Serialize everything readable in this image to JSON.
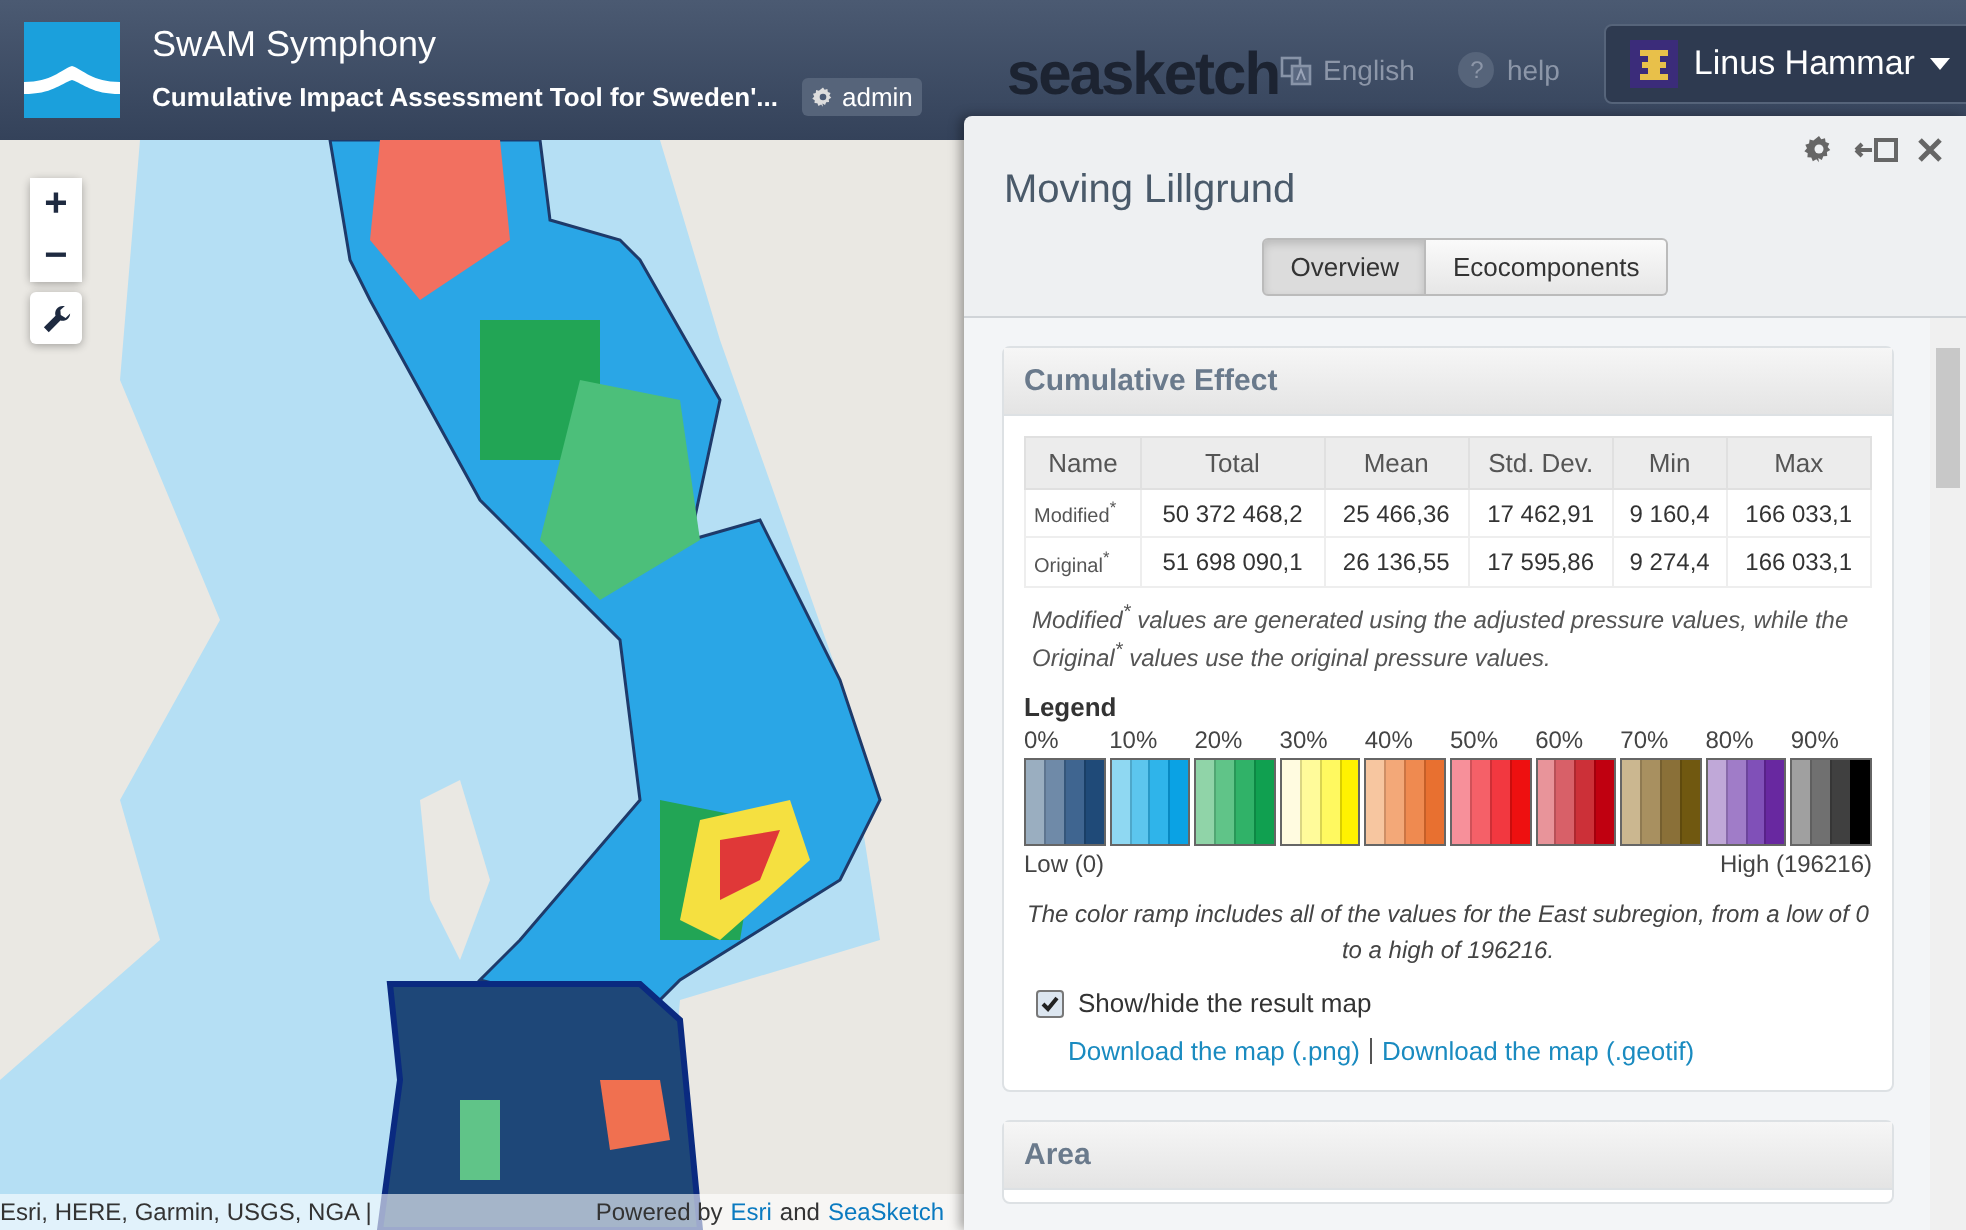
{
  "header": {
    "app_title": "SwAM Symphony",
    "app_subtitle": "Cumulative Impact Assessment Tool for Sweden'...",
    "admin_badge": "admin",
    "brand_text": "seasketch",
    "language": "English",
    "help_icon": "?",
    "help": "help",
    "user_name": "Linus Hammar"
  },
  "map": {
    "zoom_in": "+",
    "zoom_out": "−",
    "attribution": "Esri, HERE, Garmin, USGS, NGA |",
    "powered": {
      "prefix": "Powered by",
      "link_1": "Esri",
      "middle": "and",
      "link_2": "SeaSketch"
    }
  },
  "panel": {
    "title": "Moving Lillgrund",
    "tabs": [
      {
        "label": "Overview",
        "selected": true
      },
      {
        "label": "Ecocomponents",
        "selected": false
      }
    ],
    "cumulative_effect": {
      "heading": "Cumulative Effect",
      "table": {
        "columns": [
          "Name",
          "Total",
          "Mean",
          "Std. Dev.",
          "Min",
          "Max"
        ],
        "rows": [
          [
            "Modified$^{*}$",
            "50 372 468,2",
            "25 466,36",
            "17 462,91",
            "9 160,4",
            "166 033,1"
          ],
          [
            "Original$^{*}$",
            "51 698 090,1",
            "26 136,55",
            "17 595,86",
            "9 274,4",
            "166 033,1"
          ]
        ]
      },
      "note": "*Modified*$^{*}$ values are generated using the adjusted pressure values, while the *Original*$^{*}$ values use the original pressure values.",
      "legend": {
        "title": "Legend",
        "low": "Low (0)",
        "high": "High (196216)",
        "groups": [
          {
            "label": "0%",
            "swatches": [
              {
                "color": "#9aaec0"
              },
              {
                "color": "#6f8aa8"
              },
              {
                "color": "#3f6590"
              },
              {
                "color": "#1f4a78"
              }
            ]
          },
          {
            "label": "10%",
            "swatches": [
              {
                "color": "#8fd8f2"
              },
              {
                "color": "#5cc6ee"
              },
              {
                "color": "#2fb4ea"
              },
              {
                "color": "#0aa2e4"
              }
            ]
          },
          {
            "label": "20%",
            "swatches": [
              {
                "color": "#90d4a8"
              },
              {
                "color": "#60c488"
              },
              {
                "color": "#30b268"
              },
              {
                "color": "#10a050"
              }
            ]
          },
          {
            "label": "30%",
            "swatches": [
              {
                "color": "#fffbe0"
              },
              {
                "color": "#fffb9a"
              },
              {
                "color": "#fff960"
              },
              {
                "color": "#fff200"
              }
            ]
          },
          {
            "label": "40%",
            "swatches": [
              {
                "color": "#f7c6a0"
              },
              {
                "color": "#f3a878"
              },
              {
                "color": "#ef8a50"
              },
              {
                "color": "#e87030"
              }
            ]
          },
          {
            "label": "50%",
            "swatches": [
              {
                "color": "#f7909a"
              },
              {
                "color": "#f56068"
              },
              {
                "color": "#f23840"
              },
              {
                "color": "#ee1010"
              }
            ]
          },
          {
            "label": "60%",
            "swatches": [
              {
                "color": "#e8949a"
              },
              {
                "color": "#d86068"
              },
              {
                "color": "#cc3038"
              },
              {
                "color": "#c00010"
              }
            ]
          },
          {
            "label": "70%",
            "swatches": [
              {
                "color": "#cbb790"
              },
              {
                "color": "#a89060"
              },
              {
                "color": "#8a7038"
              },
              {
                "color": "#705810"
              }
            ]
          },
          {
            "label": "80%",
            "swatches": [
              {
                "color": "#c0a8d8"
              },
              {
                "color": "#a07cc8"
              },
              {
                "color": "#8050b8"
              },
              {
                "color": "#6828a0"
              }
            ]
          },
          {
            "label": "90%",
            "swatches": [
              {
                "color": "#a0a0a0"
              },
              {
                "color": "#707070"
              },
              {
                "color": "#404040"
              },
              {
                "color": "#000000"
              }
            ]
          }
        ]
      },
      "ramp_note": "The color ramp includes all of the values for the East subregion, from a low of 0 to a high of 196216.",
      "show_map": {
        "label": "Show/hide the result map",
        "checked": true
      },
      "downloads": [
        "Download the map (.png)",
        "Download the map (.geotif)"
      ]
    },
    "area": {
      "heading": "Area"
    }
  }
}
